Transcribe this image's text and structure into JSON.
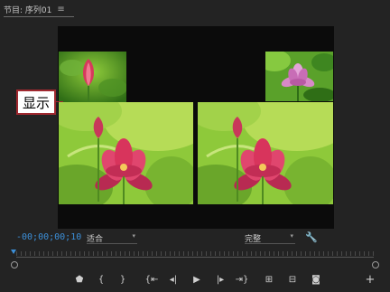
{
  "panel": {
    "title": "节目: 序列01",
    "menu_icon": "≡"
  },
  "annotation": {
    "label": "显示"
  },
  "status": {
    "timecode": "-00;00;00;10",
    "zoom_select": "适合",
    "resolution_select": "完整"
  },
  "colors": {
    "accent": "#3c8fd8",
    "annotation_border": "#a0282f"
  },
  "controls": [
    {
      "name": "add-marker-icon",
      "glyph": "⬟"
    },
    {
      "name": "mark-in-icon",
      "glyph": "{"
    },
    {
      "name": "mark-out-icon",
      "glyph": "}"
    },
    {
      "name": "go-to-in-icon",
      "glyph": "{⇤"
    },
    {
      "name": "step-back-icon",
      "glyph": "◂|"
    },
    {
      "name": "play-icon",
      "glyph": "▶"
    },
    {
      "name": "step-forward-icon",
      "glyph": "|▸"
    },
    {
      "name": "go-to-out-icon",
      "glyph": "⇥}"
    },
    {
      "name": "insert-icon",
      "glyph": "⊞"
    },
    {
      "name": "overwrite-icon",
      "glyph": "⊟"
    },
    {
      "name": "export-frame-icon",
      "glyph": "◙"
    },
    {
      "name": "add-button-icon",
      "glyph": "+"
    }
  ]
}
